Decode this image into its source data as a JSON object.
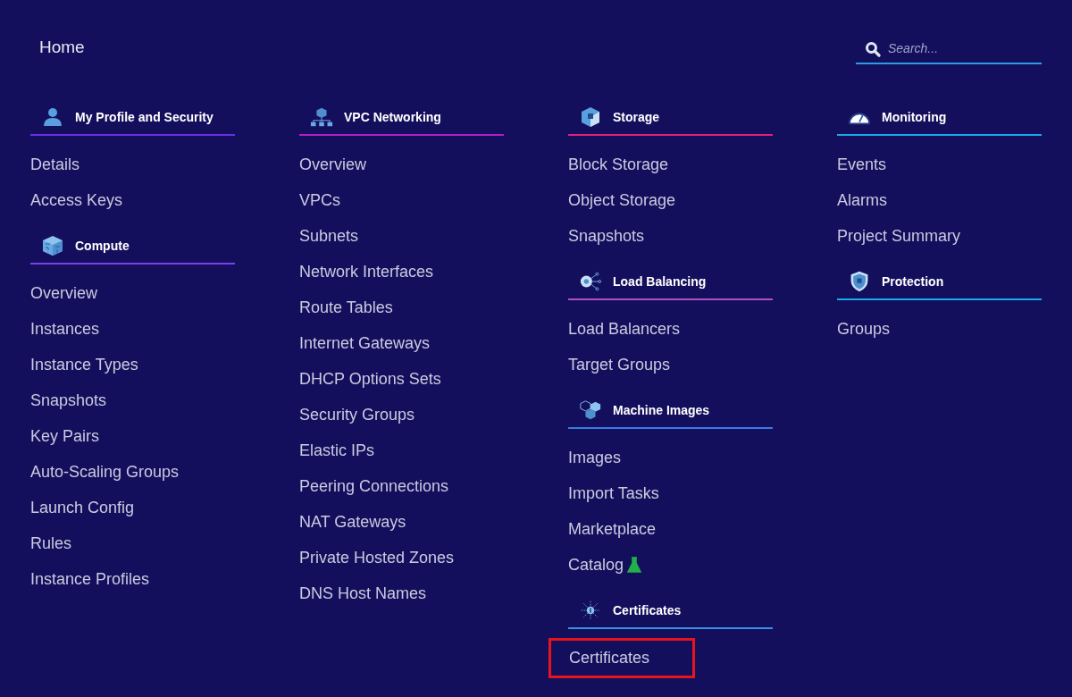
{
  "header": {
    "title": "Home",
    "search": {
      "placeholder": "Search..."
    }
  },
  "columns": [
    {
      "sections": [
        {
          "title": "My Profile and Security",
          "kind": "person",
          "color": "#6a2ee8",
          "items": [
            {
              "label": "Details",
              "highlighted": false
            },
            {
              "label": "Access Keys",
              "highlighted": false
            }
          ]
        },
        {
          "title": "Compute",
          "kind": "chip-cube",
          "color": "#7b3ff0",
          "items": [
            {
              "label": "Overview",
              "highlighted": false
            },
            {
              "label": "Instances",
              "highlighted": false
            },
            {
              "label": "Instance Types",
              "highlighted": false
            },
            {
              "label": "Snapshots",
              "highlighted": false
            },
            {
              "label": "Key Pairs",
              "highlighted": false
            },
            {
              "label": "Auto-Scaling Groups",
              "highlighted": false
            },
            {
              "label": "Launch Config",
              "highlighted": false
            },
            {
              "label": "Rules",
              "highlighted": false
            },
            {
              "label": "Instance Profiles",
              "highlighted": false
            }
          ]
        }
      ]
    },
    {
      "sections": [
        {
          "title": "VPC Networking",
          "kind": "network",
          "color": "#b41fc0",
          "items": [
            {
              "label": "Overview",
              "highlighted": false
            },
            {
              "label": "VPCs",
              "highlighted": false
            },
            {
              "label": "Subnets",
              "highlighted": false
            },
            {
              "label": "Network Interfaces",
              "highlighted": false
            },
            {
              "label": "Route Tables",
              "highlighted": false
            },
            {
              "label": "Internet Gateways",
              "highlighted": false
            },
            {
              "label": "DHCP Options Sets",
              "highlighted": false
            },
            {
              "label": "Security Groups",
              "highlighted": false
            },
            {
              "label": "Elastic IPs",
              "highlighted": false
            },
            {
              "label": "Peering Connections",
              "highlighted": false
            },
            {
              "label": "NAT Gateways",
              "highlighted": false
            },
            {
              "label": "Private Hosted Zones",
              "highlighted": false
            },
            {
              "label": "DNS Host Names",
              "highlighted": false
            }
          ]
        }
      ]
    },
    {
      "sections": [
        {
          "title": "Storage",
          "kind": "cube",
          "color": "#e0207e",
          "items": [
            {
              "label": "Block Storage",
              "highlighted": false
            },
            {
              "label": "Object Storage",
              "highlighted": false
            },
            {
              "label": "Snapshots",
              "highlighted": false
            }
          ]
        },
        {
          "title": "Load Balancing",
          "kind": "hub",
          "color": "#b04fc0",
          "items": [
            {
              "label": "Load Balancers",
              "highlighted": false
            },
            {
              "label": "Target Groups",
              "highlighted": false
            }
          ]
        },
        {
          "title": "Machine Images",
          "kind": "cubes",
          "color": "#3a7be0",
          "items": [
            {
              "label": "Images",
              "highlighted": false
            },
            {
              "label": "Import Tasks",
              "highlighted": false
            },
            {
              "label": "Marketplace",
              "highlighted": false
            },
            {
              "label": "Catalog",
              "highlighted": false,
              "beta": true
            }
          ]
        },
        {
          "title": "Certificates",
          "kind": "star-node",
          "color": "#3a8fe0",
          "items": [
            {
              "label": "Certificates",
              "highlighted": true
            }
          ]
        }
      ]
    },
    {
      "sections": [
        {
          "title": "Monitoring",
          "kind": "gauge",
          "color": "#1aa8e8",
          "items": [
            {
              "label": "Events",
              "highlighted": false
            },
            {
              "label": "Alarms",
              "highlighted": false
            },
            {
              "label": "Project Summary",
              "highlighted": false
            }
          ]
        },
        {
          "title": "Protection",
          "kind": "shield",
          "color": "#1aa8e8",
          "items": [
            {
              "label": "Groups",
              "highlighted": false
            }
          ]
        }
      ]
    }
  ]
}
